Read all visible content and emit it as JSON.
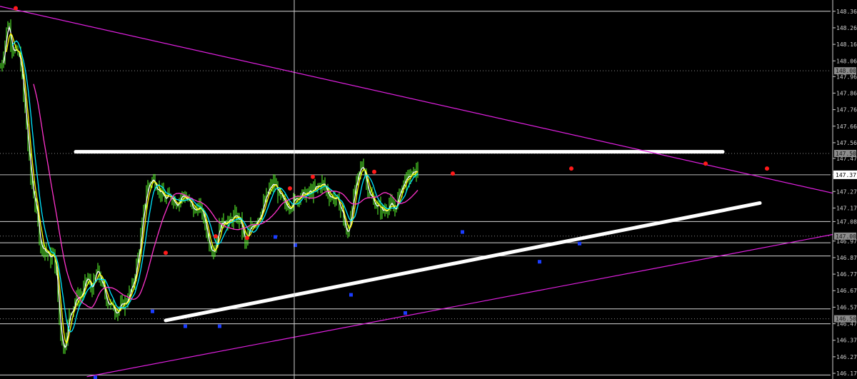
{
  "chart_data": {
    "type": "line",
    "title": "",
    "xlabel": "",
    "ylabel": "",
    "ylim": [
      146.14,
      148.385
    ],
    "y_ticks": [
      "148.360",
      "148.260",
      "148.160",
      "148.060",
      "147.965",
      "147.865",
      "147.765",
      "147.665",
      "147.565",
      "147.470",
      "147.371",
      "147.270",
      "147.170",
      "147.088",
      "146.970",
      "146.870",
      "146.770",
      "146.670",
      "146.570",
      "146.470",
      "146.370",
      "146.270",
      "146.170"
    ],
    "current_price": "147.371",
    "levels": [
      {
        "label": "148.000",
        "value": 148.0
      },
      {
        "label": "147.500",
        "value": 147.5
      },
      {
        "label": "147.000",
        "value": 147.0
      },
      {
        "label": "146.500",
        "value": 146.5
      }
    ],
    "n_bars": 250,
    "series": [
      {
        "kind": "candles",
        "color": "#5cff2e",
        "anchors": [
          [
            0,
            148.02
          ],
          [
            4,
            148.1
          ],
          [
            8,
            148.25
          ],
          [
            11,
            148.3
          ],
          [
            15,
            148.15
          ],
          [
            20,
            148.12
          ],
          [
            27,
            148.08
          ],
          [
            36,
            147.65
          ],
          [
            42,
            147.35
          ],
          [
            50,
            147.15
          ],
          [
            55,
            146.95
          ],
          [
            62,
            146.92
          ],
          [
            70,
            146.86
          ],
          [
            74,
            146.9
          ],
          [
            78,
            146.75
          ],
          [
            82,
            146.48
          ],
          [
            88,
            146.3
          ],
          [
            96,
            146.52
          ],
          [
            105,
            146.62
          ],
          [
            115,
            146.65
          ],
          [
            120,
            146.75
          ],
          [
            128,
            146.68
          ],
          [
            135,
            146.8
          ],
          [
            142,
            146.7
          ],
          [
            150,
            146.6
          ],
          [
            162,
            146.55
          ],
          [
            175,
            146.6
          ],
          [
            185,
            146.7
          ],
          [
            195,
            146.95
          ],
          [
            200,
            147.15
          ],
          [
            205,
            147.3
          ],
          [
            213,
            147.35
          ],
          [
            222,
            147.28
          ],
          [
            230,
            147.22
          ],
          [
            238,
            147.25
          ],
          [
            246,
            147.2
          ],
          [
            255,
            147.25
          ],
          [
            262,
            147.22
          ],
          [
            270,
            147.15
          ],
          [
            278,
            147.18
          ],
          [
            285,
            147.1
          ],
          [
            292,
            146.95
          ],
          [
            300,
            146.92
          ],
          [
            305,
            147.05
          ],
          [
            313,
            147.1
          ],
          [
            320,
            147.08
          ],
          [
            327,
            147.12
          ],
          [
            335,
            147.1
          ],
          [
            342,
            146.95
          ],
          [
            350,
            147.05
          ],
          [
            358,
            147.1
          ],
          [
            365,
            147.15
          ],
          [
            375,
            147.28
          ],
          [
            383,
            147.32
          ],
          [
            390,
            147.25
          ],
          [
            398,
            147.18
          ],
          [
            408,
            147.2
          ],
          [
            418,
            147.25
          ],
          [
            428,
            147.25
          ],
          [
            440,
            147.28
          ],
          [
            450,
            147.32
          ],
          [
            460,
            147.25
          ],
          [
            470,
            147.22
          ],
          [
            478,
            147.15
          ],
          [
            485,
            146.98
          ],
          [
            492,
            147.2
          ],
          [
            500,
            147.35
          ],
          [
            507,
            147.45
          ],
          [
            513,
            147.3
          ],
          [
            520,
            147.22
          ],
          [
            528,
            147.18
          ],
          [
            536,
            147.15
          ],
          [
            545,
            147.2
          ],
          [
            550,
            147.15
          ],
          [
            556,
            147.22
          ],
          [
            563,
            147.32
          ],
          [
            570,
            147.35
          ],
          [
            578,
            147.38
          ],
          [
            585,
            147.4
          ]
        ],
        "spread": 0.06
      },
      {
        "kind": "ma",
        "name": "",
        "color": "#ffffff",
        "period": 3
      },
      {
        "kind": "ma",
        "name": "",
        "color": "#ffff00",
        "period": 5
      },
      {
        "kind": "ma",
        "name": "",
        "color": "#00e5ff",
        "period": 9
      },
      {
        "kind": "ma",
        "name": "",
        "color": "#ff33cc",
        "period": 24
      }
    ],
    "swing_highs": [
      {
        "x": 11,
        "y": 148.37
      },
      {
        "x": 116,
        "y": 146.89
      },
      {
        "x": 151,
        "y": 146.99
      },
      {
        "x": 173,
        "y": 146.98
      },
      {
        "x": 203,
        "y": 147.28
      },
      {
        "x": 219,
        "y": 147.35
      },
      {
        "x": 262,
        "y": 147.38
      },
      {
        "x": 317,
        "y": 147.37
      },
      {
        "x": 400,
        "y": 147.4
      },
      {
        "x": 494,
        "y": 147.43
      },
      {
        "x": 537,
        "y": 147.4
      },
      {
        "x": 590,
        "y": 147.43
      }
    ],
    "swing_lows": [
      {
        "x": 67,
        "y": 146.16
      },
      {
        "x": 107,
        "y": 146.56
      },
      {
        "x": 130,
        "y": 146.47
      },
      {
        "x": 154,
        "y": 146.47
      },
      {
        "x": 193,
        "y": 147.01
      },
      {
        "x": 207,
        "y": 146.96
      },
      {
        "x": 246,
        "y": 146.66
      },
      {
        "x": 284,
        "y": 146.55
      },
      {
        "x": 324,
        "y": 147.04
      },
      {
        "x": 378,
        "y": 146.86
      },
      {
        "x": 406,
        "y": 146.97
      }
    ],
    "trendlines": [
      {
        "color": "#ffffff",
        "width": "thick",
        "from": [
          53,
          147.51
        ],
        "to": [
          506,
          147.51
        ]
      },
      {
        "color": "#ffffff",
        "width": "thick",
        "from": [
          116,
          146.49
        ],
        "to": [
          532,
          147.2
        ]
      },
      {
        "color": "#e020e0",
        "width": "thin",
        "from": [
          0,
          148.39
        ],
        "to": [
          583,
          147.26
        ]
      },
      {
        "color": "#e020e0",
        "width": "thin",
        "from": [
          61,
          146.15
        ],
        "to": [
          583,
          147.01
        ]
      }
    ],
    "horizontal_rays": [
      {
        "value": 148.36,
        "color": "#d8d8d8",
        "style": "solid"
      },
      {
        "value": 148.0,
        "color": "#888888",
        "style": "dotted"
      },
      {
        "value": 147.5,
        "color": "#888888",
        "style": "dotted"
      },
      {
        "value": 147.371,
        "color": "#bbbbbb",
        "style": "solid"
      },
      {
        "value": 147.088,
        "color": "#d8d8d8",
        "style": "solid"
      },
      {
        "value": 147.0,
        "color": "#888888",
        "style": "dotted"
      },
      {
        "value": 146.96,
        "color": "#d8d8d8",
        "style": "solid"
      },
      {
        "value": 146.88,
        "color": "#d8d8d8",
        "style": "solid"
      },
      {
        "value": 146.56,
        "color": "#d8d8d8",
        "style": "solid"
      },
      {
        "value": 146.5,
        "color": "#888888",
        "style": "dotted"
      },
      {
        "value": 146.47,
        "color": "#d8d8d8",
        "style": "solid"
      },
      {
        "value": 146.16,
        "color": "#d8d8d8",
        "style": "solid"
      }
    ],
    "crosshair_x": 206,
    "grid": false,
    "background": "#000000",
    "axis_color": "#cccccc"
  }
}
